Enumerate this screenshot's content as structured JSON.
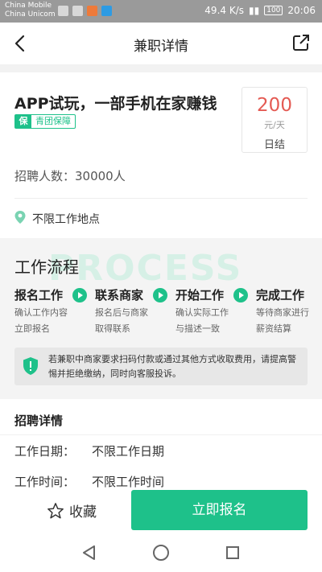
{
  "status_bar": {
    "carrier1": "China Mobile",
    "carrier2": "China Unicom",
    "speed": "49.4 K/s",
    "battery": "100",
    "time": "20:06"
  },
  "header": {
    "title": "兼职详情",
    "back_icon": "chevron-left-icon",
    "share_icon": "share-icon"
  },
  "job": {
    "title": "APP试玩，一部手机在家赚钱",
    "tag_badge": "保",
    "tag_text": "青团保障",
    "salary_amount": "200",
    "salary_unit": "元/天",
    "settlement": "日结",
    "recruit_count": "招聘人数：30000人",
    "location": "不限工作地点"
  },
  "process": {
    "title": "工作流程",
    "watermark": "PROCESS",
    "steps": [
      {
        "title": "报名工作",
        "line1": "确认工作内容",
        "line2": "立即报名"
      },
      {
        "title": "联系商家",
        "line1": "报名后与商家",
        "line2": "取得联系"
      },
      {
        "title": "开始工作",
        "line1": "确认实际工作",
        "line2": "与描述一致"
      },
      {
        "title": "完成工作",
        "line1": "等待商家进行",
        "line2": "薪资结算"
      }
    ],
    "warning": "若兼职中商家要求扫码付款或通过其他方式收取费用，请提高警惕并拒绝缴纳，同时向客服投诉。"
  },
  "details": {
    "title": "招聘详情",
    "rows": [
      {
        "label": "工作日期：",
        "value": "不限工作日期"
      },
      {
        "label": "工作时间：",
        "value": "不限工作时间"
      }
    ]
  },
  "actions": {
    "favorite": "收藏",
    "apply": "立即报名"
  },
  "colors": {
    "accent": "#1ec18a",
    "salary": "#e45a53"
  }
}
